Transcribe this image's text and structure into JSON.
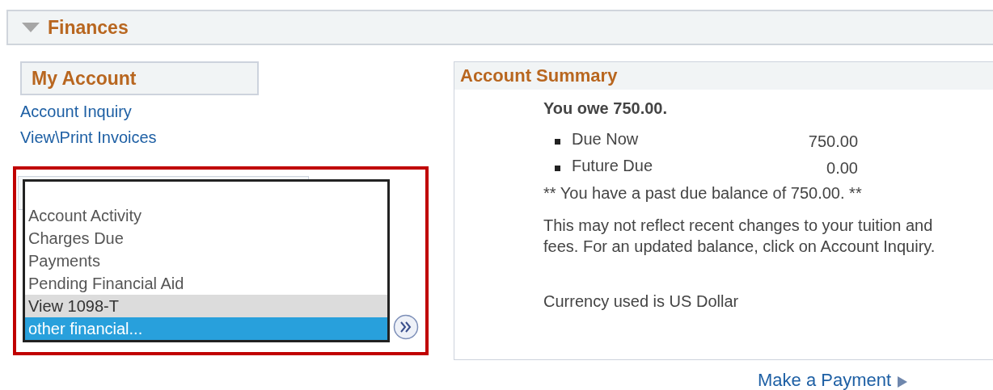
{
  "section": {
    "title": "Finances",
    "expanded": true
  },
  "my_account": {
    "title": "My Account",
    "links": [
      "Account Inquiry",
      "View\\Print Invoices"
    ]
  },
  "dropdown": {
    "options": [
      {
        "label": "Account Activity",
        "hovered": false,
        "selected": false
      },
      {
        "label": "Charges Due",
        "hovered": false,
        "selected": false
      },
      {
        "label": "Payments",
        "hovered": false,
        "selected": false
      },
      {
        "label": "Pending Financial Aid",
        "hovered": false,
        "selected": false
      },
      {
        "label": "View 1098-T",
        "hovered": true,
        "selected": false
      },
      {
        "label": "other financial...",
        "hovered": false,
        "selected": true
      }
    ]
  },
  "account_summary": {
    "title": "Account Summary",
    "owe": "You owe 750.00.",
    "items": [
      {
        "label": "Due Now",
        "amount": "750.00"
      },
      {
        "label": "Future Due",
        "amount": "0.00"
      }
    ],
    "past_due": "** You have a past due balance of 750.00. **",
    "note": "This may not reflect recent changes to your tuition and fees.  For an updated balance, click on Account Inquiry.",
    "currency": "Currency used is US Dollar"
  },
  "make_payment": "Make a Payment"
}
